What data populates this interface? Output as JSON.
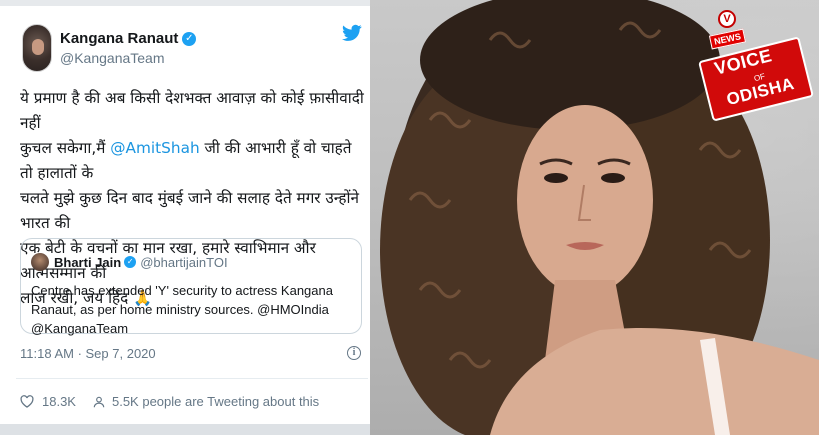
{
  "tweet": {
    "author_name": "Kangana Ranaut",
    "author_handle": "@KanganaTeam",
    "verified_mark": "✓",
    "text_lines": [
      "ये प्रमाण है की अब किसी देशभक्त आवाज़ को कोई फ़ासीवादी नहीं",
      "कुचल सकेगा,मैं",
      "@AmitShah",
      "जी की आभारी हूँ वो चाहते तो हालातों के",
      "चलते मुझे कुछ दिन बाद मुंबई जाने की सलाह देते मगर उन्होंने भारत की",
      "एक बेटी के वचनों का मान रखा, हमारे स्वाभिमान और आत्मसम्मान की",
      "लाज रखी, जय हिंद 🙏"
    ],
    "timestamp": "11:18 AM · Sep 7, 2020",
    "info_symbol": "i",
    "likes": "18.3K",
    "people_tweeting": "5.5K people are Tweeting about this"
  },
  "quoted_tweet": {
    "author_name": "Bharti Jain",
    "author_handle": "@bhartijainTOI",
    "verified_mark": "✓",
    "text": "Centre has extended 'Y' security to actress Kangana Ranaut, as per home ministry sources. @HMOIndia @KanganaTeam"
  },
  "brand": {
    "v_mark": "V",
    "news_tag": "NEWS",
    "voice": "VOICE",
    "of": "OF",
    "odisha": "ODISHA"
  },
  "colors": {
    "twitter_blue": "#1da1f2",
    "mention_blue": "#1b95e0",
    "secondary_text": "#657786",
    "brand_red": "#d10a0a"
  },
  "icons": {
    "bird": "twitter-bird-icon",
    "heart": "heart-icon",
    "people": "people-icon",
    "info": "info-icon"
  }
}
